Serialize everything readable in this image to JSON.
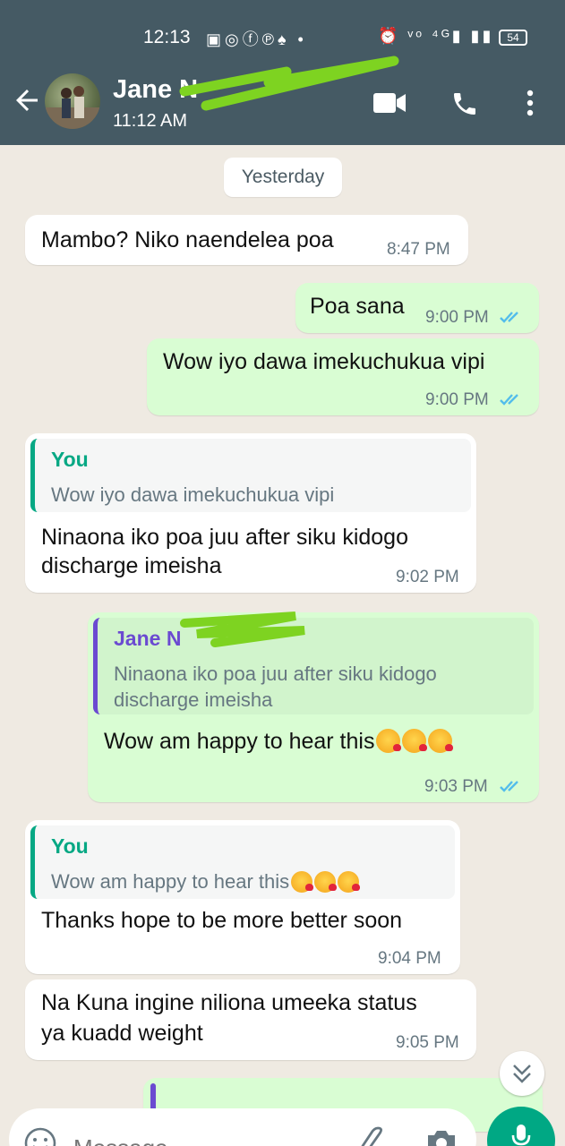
{
  "status_bar": {
    "time": "12:13",
    "battery": "54"
  },
  "header": {
    "contact_name": "Jane N",
    "last_seen": "11:12 AM"
  },
  "chat": {
    "date_divider": "Yesterday",
    "messages": [
      {
        "direction": "in",
        "text": "Mambo? Niko naendelea poa",
        "time": "8:47 PM"
      },
      {
        "direction": "out",
        "text": "Poa sana",
        "time": "9:00 PM"
      },
      {
        "direction": "out",
        "text": "Wow iyo dawa imekuchukua vipi",
        "time": "9:00 PM"
      },
      {
        "direction": "in",
        "quote_author": "You",
        "quote_text": "Wow iyo dawa imekuchukua vipi",
        "text_line1": "Ninaona iko poa juu after siku kidogo",
        "text_line2": "discharge imeisha",
        "time": "9:02 PM"
      },
      {
        "direction": "out",
        "quote_author": "Jane N",
        "quote_line1": "Ninaona iko poa juu after siku kidogo",
        "quote_line2": "discharge imeisha",
        "text": "Wow am happy to hear this",
        "time": "9:03 PM"
      },
      {
        "direction": "in",
        "quote_author": "You",
        "quote_text": "Wow am happy to hear this",
        "text": "Thanks hope to be more better soon",
        "time": "9:04 PM"
      },
      {
        "direction": "in",
        "text_line1": "Na Kuna ingine niliona umeeka status",
        "text_line2": "ya kuadd weight",
        "time": "9:05 PM"
      }
    ]
  },
  "composer": {
    "placeholder": "Message"
  },
  "colors": {
    "header": "#455a64",
    "outgoing": "#d9fdd3",
    "incoming": "#ffffff",
    "accent": "#00a884",
    "tick": "#53bdeb"
  },
  "icons": [
    "back-arrow-icon",
    "video-call-icon",
    "phone-icon",
    "more-vert-icon",
    "emoji-icon",
    "attach-icon",
    "camera-icon",
    "mic-icon",
    "double-chevron-down-icon",
    "double-tick-icon"
  ]
}
